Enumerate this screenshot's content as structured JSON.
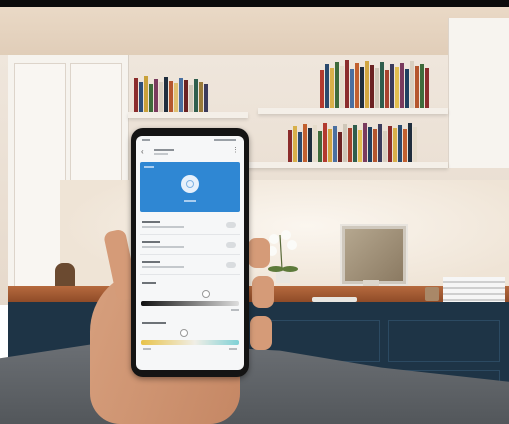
{
  "scene": {
    "description_colors": {
      "wall": "#efe6dc",
      "desk": "#a85c33",
      "cabinet": "#1e3446",
      "sofa": "#5f6368",
      "app_accent": "#2f87d3"
    }
  },
  "phone_app": {
    "hero_icon": "lightbulb-power-icon",
    "back_icon": "arrow-left-icon",
    "menu_icon": "more-vertical-icon",
    "toggle_rows": 3,
    "sliders": [
      "brightness",
      "color-temperature"
    ]
  }
}
